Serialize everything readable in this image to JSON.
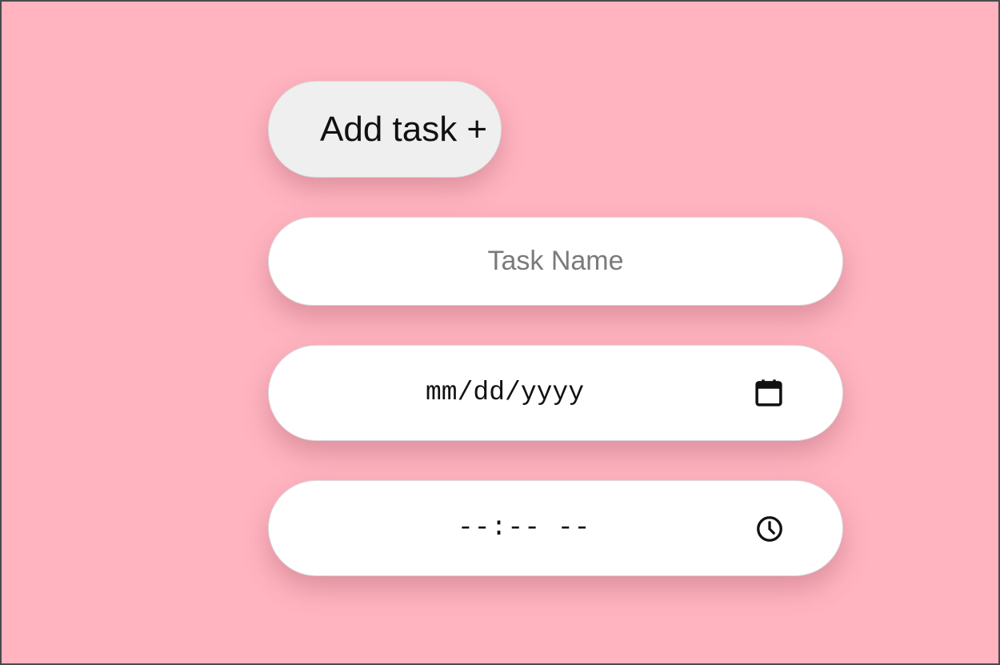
{
  "add_button": {
    "label": "Add task +"
  },
  "task_name_input": {
    "value": "",
    "placeholder": "Task Name"
  },
  "date_input": {
    "display": "mm/dd/yyyy",
    "icon": "calendar-icon"
  },
  "time_input": {
    "display": "--:-- --",
    "icon": "clock-icon"
  },
  "colors": {
    "background": "#FFB4C0",
    "button_bg": "#EFEFEF",
    "field_bg": "#FFFFFF"
  }
}
